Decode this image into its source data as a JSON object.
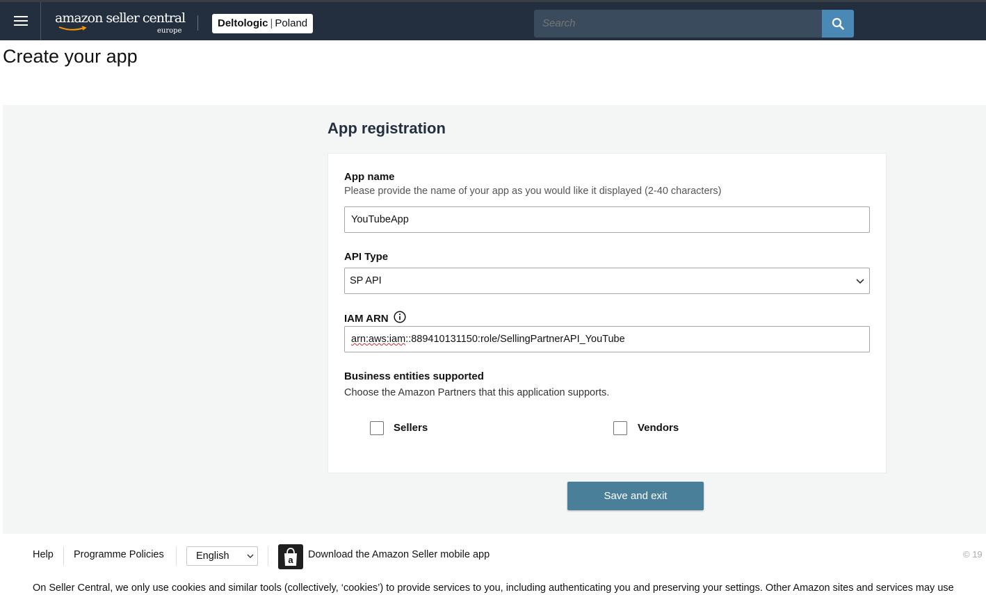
{
  "header": {
    "logo_main": "amazon seller central",
    "logo_sub": "europe",
    "account_name": "Deltologic",
    "account_region": "Poland",
    "search_placeholder": "Search"
  },
  "page": {
    "title": "Create your app"
  },
  "form": {
    "section_title": "App registration",
    "app_name_label": "App name",
    "app_name_hint": "Please provide the name of your app as you would like it displayed (2-40 characters)",
    "app_name_value": "YouTubeApp",
    "api_type_label": "API Type",
    "api_type_value": "SP API",
    "iam_arn_label": "IAM ARN",
    "iam_arn_value_underlined": "arn:aws:iam",
    "iam_arn_value_rest": "::889410131150:role/SellingPartnerAPI_YouTube",
    "business_label": "Business entities supported",
    "business_hint": "Choose the Amazon Partners that this application supports.",
    "checkboxes": [
      {
        "label": "Sellers",
        "checked": false
      },
      {
        "label": "Vendors",
        "checked": false
      }
    ],
    "save_button": "Save and exit"
  },
  "footer": {
    "help": "Help",
    "policies": "Programme Policies",
    "language": "English",
    "download_app": "Download the Amazon Seller mobile app",
    "copyright": "© 19",
    "cookie_text": "On Seller Central, we only use cookies and similar tools (collectively, ‘cookies’) to provide services to you, including authenticating you and preserving your settings. Other Amazon sites and services may use"
  },
  "colors": {
    "header_bg": "#232f3e",
    "search_button": "#4a88b5",
    "primary_button": "#4a7f9a"
  },
  "icons": [
    "hamburger-icon",
    "search-icon",
    "info-icon",
    "chevron-down-icon",
    "amazon-app-icon"
  ]
}
